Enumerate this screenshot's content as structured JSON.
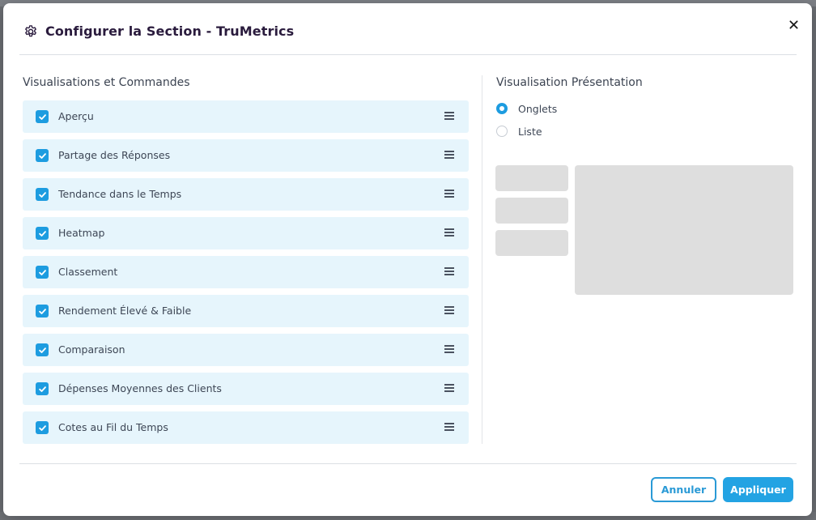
{
  "dialog": {
    "title": "Configurer la Section - TruMetrics",
    "close_label": "×"
  },
  "left_panel": {
    "title": "Visualisations et Commandes",
    "items": [
      {
        "label": "Aperçu",
        "checked": true
      },
      {
        "label": "Partage des Réponses",
        "checked": true
      },
      {
        "label": "Tendance dans le Temps",
        "checked": true
      },
      {
        "label": "Heatmap",
        "checked": true
      },
      {
        "label": "Classement",
        "checked": true
      },
      {
        "label": "Rendement Élevé & Faible",
        "checked": true
      },
      {
        "label": "Comparaison",
        "checked": true
      },
      {
        "label": "Dépenses Moyennes des Clients",
        "checked": true
      },
      {
        "label": "Cotes au Fil du Temps",
        "checked": true
      }
    ]
  },
  "right_panel": {
    "title": "Visualisation Présentation",
    "options": [
      {
        "label": "Onglets",
        "selected": true
      },
      {
        "label": "Liste",
        "selected": false
      }
    ]
  },
  "footer": {
    "cancel_label": "Annuler",
    "apply_label": "Appliquer"
  },
  "colors": {
    "accent": "#1d9ce0",
    "item_background": "#e6f5fc",
    "title_text": "#2a1b3d"
  }
}
